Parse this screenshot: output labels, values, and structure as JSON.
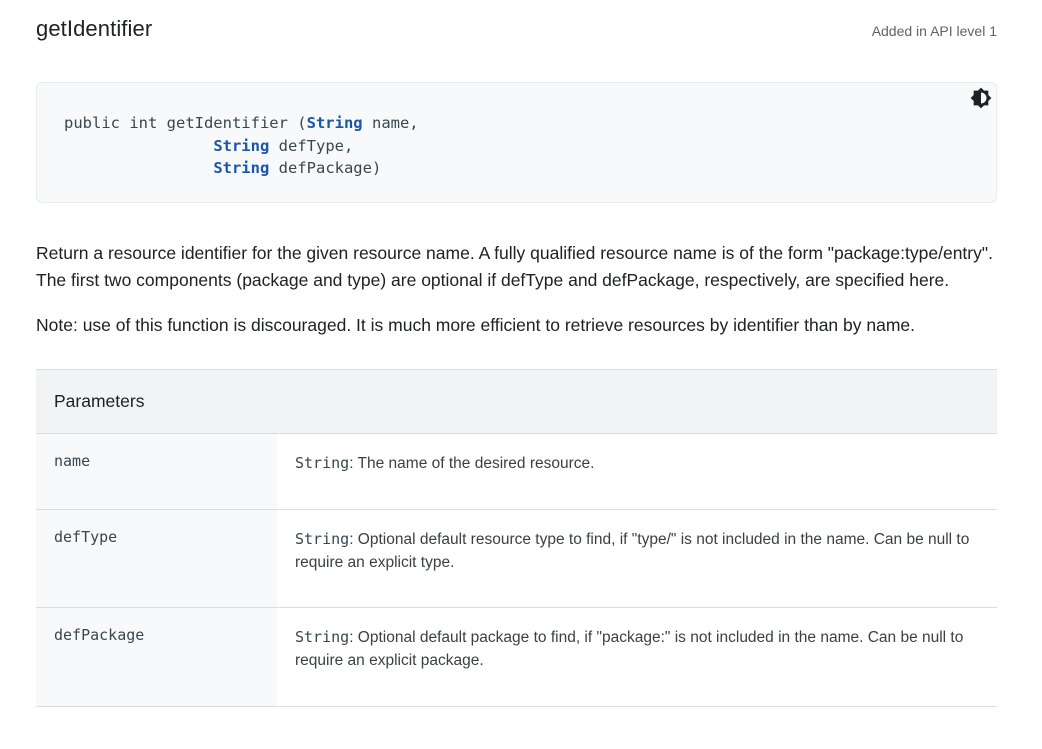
{
  "header": {
    "title": "getIdentifier",
    "api_level": "Added in API level 1"
  },
  "signature": {
    "prefix": "public int getIdentifier (",
    "params": [
      {
        "type": "String",
        "name": "name,"
      },
      {
        "type": "String",
        "name": "defType,"
      },
      {
        "type": "String",
        "name": "defPackage)"
      }
    ],
    "indent": "                ",
    "theme_toggle_icon": "contrast-icon"
  },
  "description": {
    "paragraph1": "Return a resource identifier for the given resource name. A fully qualified resource name is of the form \"package:type/entry\". The first two components (package and type) are optional if defType and defPackage, respectively, are specified here.",
    "paragraph2": "Note: use of this function is discouraged. It is much more efficient to retrieve resources by identifier than by name."
  },
  "parameters": {
    "heading": "Parameters",
    "rows": [
      {
        "name": "name",
        "type": "String",
        "description": ": The name of the desired resource."
      },
      {
        "name": "defType",
        "type": "String",
        "description": ": Optional default resource type to find, if \"type/\" is not included in the name. Can be null to require an explicit type."
      },
      {
        "name": "defPackage",
        "type": "String",
        "description": ": Optional default package to find, if \"package:\" is not included in the name. Can be null to require an explicit package."
      }
    ]
  },
  "colors": {
    "code_type_keyword": "#1a56a8",
    "code_background": "#f8f9fa",
    "table_header_background": "#f1f3f4"
  }
}
